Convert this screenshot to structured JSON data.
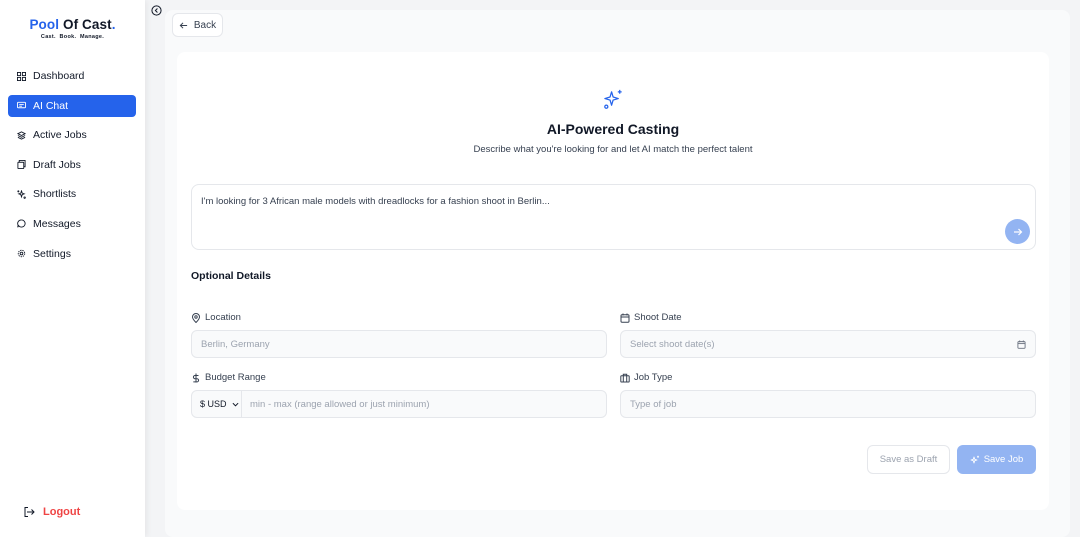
{
  "brand": {
    "pool": "Pool",
    "of_cast": "Of Cast",
    "dot": ".",
    "tagline": "Cast.  Book.  Manage."
  },
  "sidebar": {
    "items": [
      {
        "label": "Dashboard",
        "icon": "dashboard-icon",
        "active": false
      },
      {
        "label": "AI Chat",
        "icon": "chat-icon",
        "active": true
      },
      {
        "label": "Active Jobs",
        "icon": "jobs-icon",
        "active": false
      },
      {
        "label": "Draft Jobs",
        "icon": "drafts-icon",
        "active": false
      },
      {
        "label": "Shortlists",
        "icon": "shortlist-icon",
        "active": false
      },
      {
        "label": "Messages",
        "icon": "message-icon",
        "active": false
      },
      {
        "label": "Settings",
        "icon": "gear-icon",
        "active": false
      }
    ],
    "logout_label": "Logout"
  },
  "header": {
    "back_label": "Back"
  },
  "main": {
    "title": "AI-Powered Casting",
    "subtitle": "Describe what you're looking for and let AI match the perfect talent",
    "prompt_text": "I'm looking for 3 African male models with dreadlocks for a fashion shoot in Berlin...",
    "optional_title": "Optional Details",
    "location": {
      "label": "Location",
      "placeholder": "Berlin, Germany"
    },
    "shoot_date": {
      "label": "Shoot Date",
      "placeholder": "Select shoot date(s)"
    },
    "budget": {
      "label": "Budget Range",
      "currency": "$ USD",
      "placeholder": "min - max (range allowed or just minimum)"
    },
    "job_type": {
      "label": "Job Type",
      "placeholder": "Type of job"
    },
    "save_draft_label": "Save as Draft",
    "save_job_label": "Save Job"
  },
  "colors": {
    "accent": "#2563eb",
    "accent_disabled": "#93b4f2",
    "logout": "#ef4444"
  }
}
